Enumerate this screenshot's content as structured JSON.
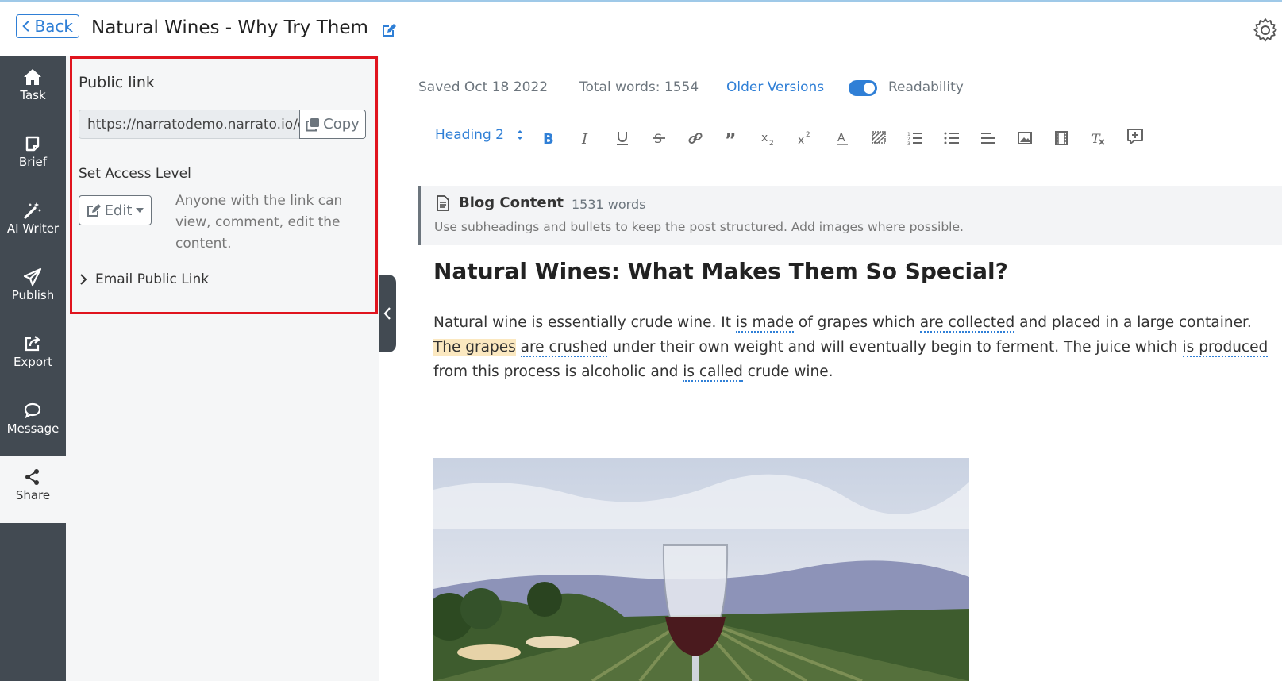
{
  "header": {
    "back_label": "Back",
    "title": "Natural Wines - Why Try Them"
  },
  "sidebar": {
    "items": [
      {
        "label": "Task",
        "icon": "home-icon"
      },
      {
        "label": "Brief",
        "icon": "brief-icon"
      },
      {
        "label": "AI Writer",
        "icon": "magic-wand-icon"
      },
      {
        "label": "Publish",
        "icon": "paper-plane-icon"
      },
      {
        "label": "Export",
        "icon": "export-icon"
      },
      {
        "label": "Message",
        "icon": "chat-bubble-icon"
      },
      {
        "label": "Share",
        "icon": "share-icon",
        "active": true
      }
    ]
  },
  "share_panel": {
    "public_link_label": "Public link",
    "public_url": "https://narratodemo.narrato.io/cw",
    "copy_label": "Copy",
    "access_label": "Set Access Level",
    "access_value": "Edit",
    "access_description": "Anyone with the link can view, comment, edit the content.",
    "email_link_label": "Email Public Link"
  },
  "status": {
    "saved": "Saved Oct 18 2022",
    "total_words": "Total words: 1554",
    "older_versions": "Older Versions",
    "readability": "Readability",
    "readability_on": true
  },
  "toolbar": {
    "heading_select": "Heading 2",
    "buttons": [
      "bold-icon",
      "italic-icon",
      "underline-icon",
      "strikethrough-icon",
      "link-icon",
      "quote-icon",
      "subscript-icon",
      "superscript-icon",
      "text-color-icon",
      "highlight-icon",
      "ordered-list-icon",
      "bullet-list-icon",
      "align-icon",
      "image-icon",
      "video-icon",
      "clear-format-icon",
      "add-comment-icon"
    ]
  },
  "content_block": {
    "title": "Blog Content",
    "word_count": "1531 words",
    "hint": "Use subheadings and bullets to keep the post structured. Add images where possible."
  },
  "article": {
    "title": "Natural Wines: What Makes Them So Special?",
    "p": {
      "s1": "Natural wine is essentially crude wine. It ",
      "pv1": "is made",
      "s2": " of grapes which ",
      "pv2": "are collected",
      "s3": " and placed in a large container. ",
      "hl": "The grapes",
      "s4": " ",
      "pv3": "are crushed",
      "s5": " under their own weight and will eventually begin to ferment. The juice which ",
      "pv4": "is produced",
      "s6": " from this process is alcoholic and ",
      "pv5": "is called",
      "s7": " crude wine."
    }
  },
  "colors": {
    "accent": "#2f7fd6",
    "sidebar": "#424a52",
    "highlight_border": "#e0141e",
    "passive_highlight": "#fbe8c0"
  }
}
